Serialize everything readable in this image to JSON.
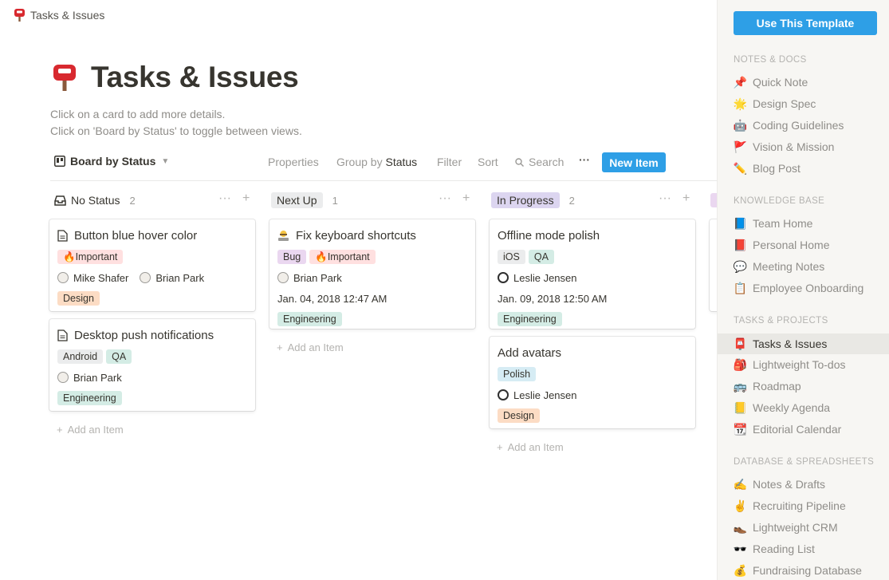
{
  "breadcrumb": {
    "title": "Tasks & Issues"
  },
  "page": {
    "title": "Tasks & Issues",
    "desc_line1": "Click on a card to add more details.",
    "desc_line2": "Click on 'Board by Status' to toggle between views."
  },
  "toolbar": {
    "view": "Board by Status",
    "properties": "Properties",
    "group_by_prefix": "Group by",
    "group_by_value": "Status",
    "filter": "Filter",
    "sort": "Sort",
    "search": "Search",
    "more": "···",
    "new_item": "New Item"
  },
  "colors": {
    "accent": "#2e9fe6",
    "tag_red": "#ffe0e0",
    "tag_purple": "#ead7f0",
    "tag_gray": "#ebeced",
    "tag_green": "#d4ece5",
    "tag_orange": "#fcdcc4",
    "tag_blue": "#d6ecf4",
    "col_gray": "#ebeced",
    "col_purple": "#dcd5f0"
  },
  "board": {
    "add_item": "Add an Item",
    "columns": [
      {
        "label": "No Status",
        "count": "2"
      },
      {
        "label": "Next Up",
        "count": "1"
      },
      {
        "label": "In Progress",
        "count": "2"
      }
    ],
    "cards": {
      "c1": {
        "title": "Button blue hover color",
        "tag1": "🔥Important",
        "person1": "Mike Shafer",
        "person2": "Brian Park",
        "tag2": "Design"
      },
      "c2": {
        "title": "Desktop push notifications",
        "tag1": "Android",
        "tag2": "QA",
        "person1": "Brian Park",
        "tag3": "Engineering"
      },
      "c3": {
        "title": "Fix keyboard shortcuts",
        "tag1": "Bug",
        "tag2": "🔥Important",
        "person1": "Brian Park",
        "date": "Jan. 04, 2018 12:47 AM",
        "tag3": "Engineering"
      },
      "c4": {
        "title": "Offline mode polish",
        "tag1": "iOS",
        "tag2": "QA",
        "person1": "Leslie Jensen",
        "date": "Jan. 09, 2018 12:50 AM",
        "tag3": "Engineering"
      },
      "c5": {
        "title": "Add avatars",
        "tag1": "Polish",
        "person1": "Leslie Jensen",
        "tag2": "Design"
      }
    }
  },
  "sidebar": {
    "use_template": "Use This Template",
    "sections": [
      {
        "label": "NOTES & DOCS",
        "items": [
          "Quick Note",
          "Design Spec",
          "Coding Guidelines",
          "Vision & Mission",
          "Blog Post"
        ]
      },
      {
        "label": "KNOWLEDGE BASE",
        "items": [
          "Team Home",
          "Personal Home",
          "Meeting Notes",
          "Employee Onboarding"
        ]
      },
      {
        "label": "TASKS & PROJECTS",
        "items": [
          "Tasks & Issues",
          "Lightweight To-dos",
          "Roadmap",
          "Weekly Agenda",
          "Editorial Calendar"
        ]
      },
      {
        "label": "DATABASE & SPREADSHEETS",
        "items": [
          "Notes & Drafts",
          "Recruiting Pipeline",
          "Lightweight CRM",
          "Reading List",
          "Fundraising Database"
        ]
      }
    ],
    "icons": {
      "notes": [
        "📌",
        "🌟",
        "🤖",
        "🚩",
        "✏️"
      ],
      "knowledge": [
        "📘",
        "📕",
        "💬",
        "📋"
      ],
      "tasks": [
        "📮",
        "🎒",
        "🚌",
        "📒",
        "📆"
      ],
      "database": [
        "✍️",
        "✌️",
        "👞",
        "🕶️",
        "💰"
      ]
    }
  }
}
